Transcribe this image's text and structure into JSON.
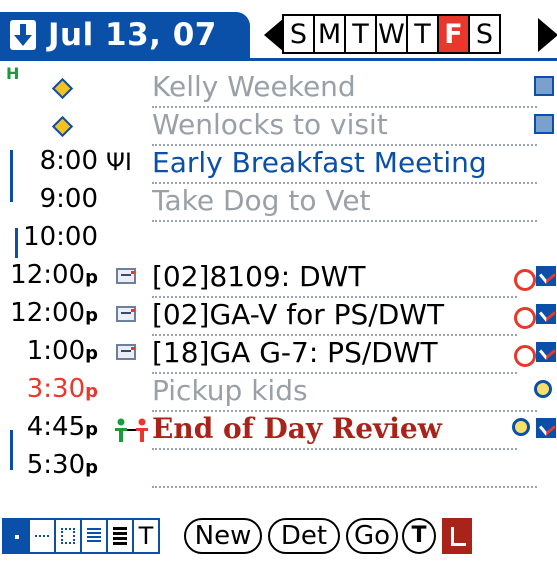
{
  "header": {
    "date": "Jul 13, 07",
    "days": [
      "S",
      "M",
      "T",
      "W",
      "T",
      "F",
      "S"
    ],
    "selected_day_index": 5
  },
  "agenda_marker": "H",
  "events": [
    {
      "time": "",
      "pm": "",
      "icon": "diamond",
      "title": "Kelly Weekend",
      "style": "gray",
      "tail": [
        "repeat-icon"
      ]
    },
    {
      "time": "",
      "pm": "",
      "icon": "diamond",
      "title": "Wenlocks to visit",
      "style": "gray",
      "tail": [
        "repeat-icon"
      ]
    },
    {
      "time": "8:00",
      "pm": "",
      "icon": "fork-knife",
      "title": "Early Breakfast Meeting",
      "style": "blue",
      "tail": []
    },
    {
      "time": "9:00",
      "pm": "",
      "icon": "",
      "title": "Take Dog to Vet",
      "style": "gray",
      "tail": []
    },
    {
      "time": "10:00",
      "pm": "",
      "icon": "",
      "title": "",
      "style": "black",
      "tail": []
    },
    {
      "time": "12:00",
      "pm": "p",
      "icon": "note",
      "title": "[02]8109: DWT",
      "style": "black",
      "tail": [
        "circle",
        "check"
      ]
    },
    {
      "time": "12:00",
      "pm": "p",
      "icon": "note",
      "title": "[02]GA-V for PS/DWT",
      "style": "black",
      "tail": [
        "circle",
        "check"
      ]
    },
    {
      "time": "1:00",
      "pm": "p",
      "icon": "note",
      "title": "[18]GA G-7: PS/DWT",
      "style": "black",
      "tail": [
        "circle",
        "check"
      ]
    },
    {
      "time": "3:30",
      "pm": "p",
      "icon": "",
      "title": "Pickup kids",
      "style": "gray",
      "tail": [
        "alarm"
      ]
    },
    {
      "time": "4:45",
      "pm": "p",
      "icon": "people",
      "title": "End of Day Review",
      "style": "red-bold",
      "tail": [
        "alarm",
        "check"
      ]
    },
    {
      "time": "5:30",
      "pm": "p",
      "icon": "",
      "title": "",
      "style": "black",
      "tail": []
    }
  ],
  "toolbar": {
    "t_view": "T",
    "new": "New",
    "details": "Det",
    "go": "Go",
    "today": "T"
  },
  "colors": {
    "brand_blue": "#0a4fa8",
    "red": "#e8382c",
    "dark_red": "#a8231a",
    "gray_text": "#9aa0a8"
  }
}
